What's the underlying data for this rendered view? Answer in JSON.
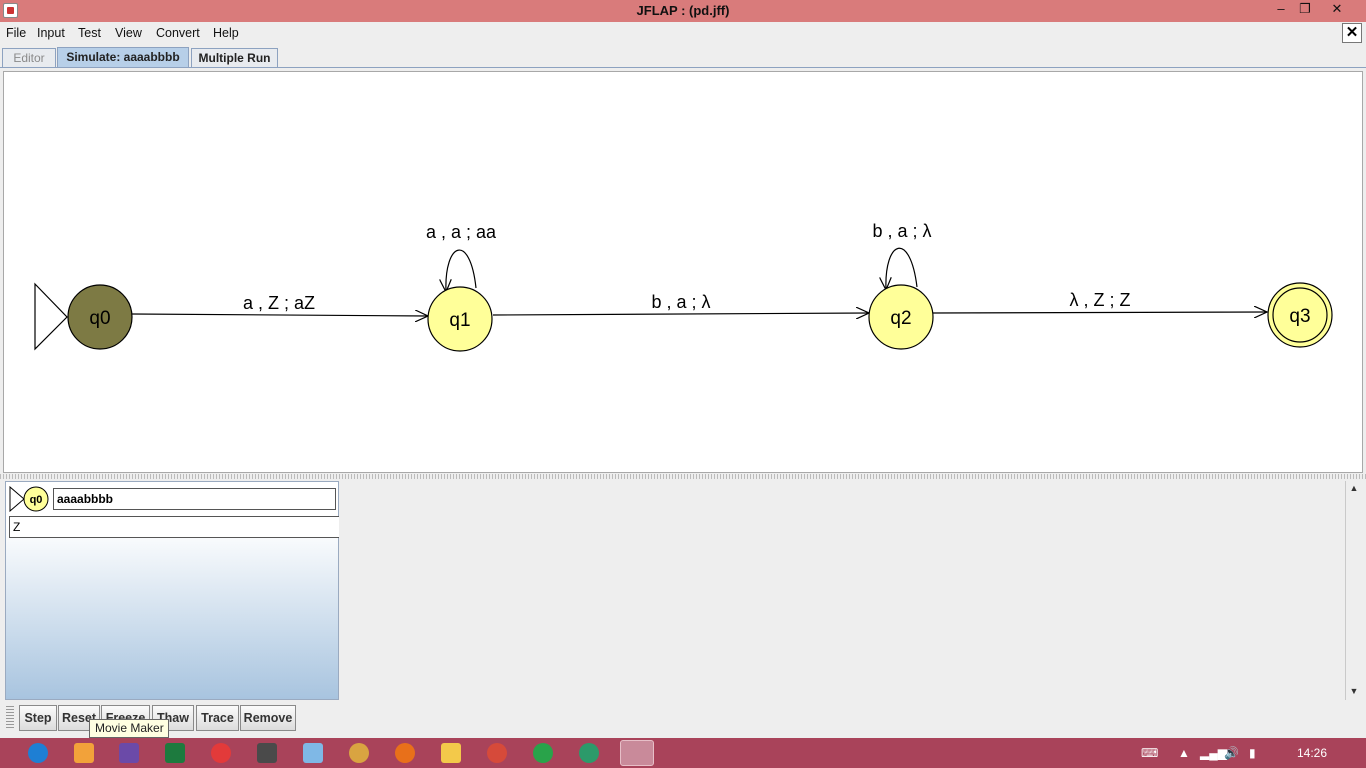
{
  "window": {
    "title": "JFLAP : (pd.jff)",
    "controls": [
      "–",
      "❐",
      "✕"
    ]
  },
  "menu": {
    "items": [
      "File",
      "Input",
      "Test",
      "View",
      "Convert",
      "Help"
    ],
    "close_glyph": "✕"
  },
  "tabs": [
    {
      "label": "Editor",
      "state": "disabled"
    },
    {
      "label": "Simulate: aaaabbbb",
      "state": "active"
    },
    {
      "label": "Multiple Run",
      "state": "normal"
    }
  ],
  "automaton": {
    "states": [
      {
        "id": "q0",
        "label": "q0",
        "initial": true,
        "final": false,
        "highlighted": true
      },
      {
        "id": "q1",
        "label": "q1",
        "initial": false,
        "final": false,
        "highlighted": false
      },
      {
        "id": "q2",
        "label": "q2",
        "initial": false,
        "final": false,
        "highlighted": false
      },
      {
        "id": "q3",
        "label": "q3",
        "initial": false,
        "final": true,
        "highlighted": false
      }
    ],
    "transitions": [
      {
        "from": "q0",
        "to": "q1",
        "label": "a , Z ; aZ"
      },
      {
        "from": "q1",
        "to": "q1",
        "label": "a , a ; aa"
      },
      {
        "from": "q1",
        "to": "q2",
        "label": "b , a ; λ"
      },
      {
        "from": "q2",
        "to": "q2",
        "label": "b , a ; λ"
      },
      {
        "from": "q2",
        "to": "q3",
        "label": "λ , Z ; Z"
      }
    ],
    "colors": {
      "state_fill": "#ffff99",
      "active_fill": "#7d7a44",
      "edge": "#000000"
    }
  },
  "configuration": {
    "state": "q0",
    "input": "aaaabbbb",
    "stack": "Z"
  },
  "toolbar": {
    "buttons": [
      "Step",
      "Reset",
      "Freeze",
      "Thaw",
      "Trace",
      "Remove"
    ],
    "tooltip": "Movie Maker"
  },
  "taskbar": {
    "apps": [
      "internet-explorer-icon",
      "store-icon",
      "winrar-icon",
      "excel-icon",
      "snipping-icon",
      "notes-icon",
      "notepad-icon",
      "paint-icon",
      "firefox-icon",
      "explorer-icon",
      "chrome-icon",
      "refresh-app-icon",
      "maps-icon",
      "java-icon"
    ],
    "clock": "14:26"
  }
}
